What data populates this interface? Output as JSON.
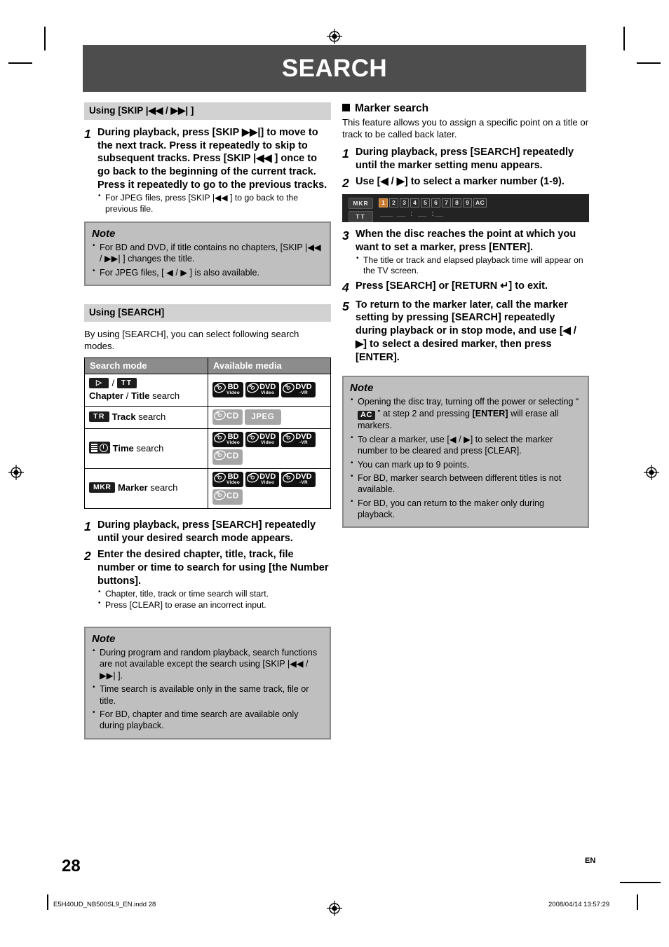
{
  "page": {
    "title": "SEARCH",
    "number": "28",
    "lang": "EN",
    "footer_file": "E5H40UD_NB500SL9_EN.indd   28",
    "footer_date": "2008/04/14   13:57:29"
  },
  "colors": {
    "banner": "#4d4d4d",
    "section_bar": "#d2d2d2",
    "note_bg": "#bfbfbf",
    "note_border": "#8a8a8a",
    "table_header": "#8c8c8c",
    "osd_bg": "#232323",
    "osd_highlight": "#c87a32",
    "media_dark": "#111111",
    "media_gray": "#a6a6a6"
  },
  "left": {
    "skip_section": {
      "bar_label": "Using [SKIP |◀◀ / ▶▶| ]",
      "steps": [
        {
          "num": "1",
          "head_parts": [
            {
              "t": "During playback, press [SKIP ",
              "s": "plain"
            },
            {
              "t": "▶▶|",
              "s": "plain"
            },
            {
              "t": "] to move to the next track. Press it repeatedly to skip to subsequent tracks. Press [SKIP |◀◀ ] once to go back to the beginning of the current track. Press it repeatedly to go to the previous tracks.",
              "s": "plain"
            }
          ],
          "head": "During playback, press [SKIP ▶▶|] to move to the next track. Press it repeatedly to skip to subsequent tracks. Press [SKIP |◀◀ ] once to go back to the beginning of the current track. Press it repeatedly to go to the previous tracks.",
          "bullets": [
            "For JPEG files, press [SKIP |◀◀ ] to go back to the previous file."
          ]
        }
      ],
      "note": {
        "title": "Note",
        "bullets": [
          "For BD and DVD, if title contains no chapters, [SKIP |◀◀ / ▶▶| ] changes the title.",
          "For JPEG files,  [ ◀ / ▶ ] is also available."
        ]
      }
    },
    "search_section": {
      "bar_label": "Using [SEARCH]",
      "intro": "By using [SEARCH], you can select following search modes.",
      "table": {
        "headers": [
          "Search mode",
          "Available media"
        ],
        "rows": [
          {
            "icons": [
              "play-badge",
              "tt-badge"
            ],
            "icon_text": [
              "▶",
              "TT"
            ],
            "label_bold_1": "Chapter",
            "label_sep": " / ",
            "label_bold_2": "Title",
            "label_tail": " search",
            "media": [
              {
                "kind": "disc-dark",
                "l1": "BD",
                "l2": "Video"
              },
              {
                "kind": "disc-dark",
                "l1": "DVD",
                "l2": "Video"
              },
              {
                "kind": "disc-dark",
                "l1": "DVD",
                "l2": "-VR"
              }
            ]
          },
          {
            "icons": [
              "tr-badge"
            ],
            "icon_text": [
              "TR"
            ],
            "label_bold_1": "Track",
            "label_tail": " search",
            "media": [
              {
                "kind": "disc-gray",
                "l1": "CD",
                "l2": ""
              },
              {
                "kind": "plain-gray",
                "l1": "JPEG",
                "l2": ""
              }
            ]
          },
          {
            "icons": [
              "time-icon"
            ],
            "icon_text": [
              ""
            ],
            "label_bold_1": "Time",
            "label_tail": " search",
            "media": [
              {
                "kind": "disc-dark",
                "l1": "BD",
                "l2": "Video"
              },
              {
                "kind": "disc-dark",
                "l1": "DVD",
                "l2": "Video"
              },
              {
                "kind": "disc-dark",
                "l1": "DVD",
                "l2": "-VR"
              },
              {
                "kind": "disc-gray",
                "l1": "CD",
                "l2": ""
              }
            ]
          },
          {
            "icons": [
              "mkr-badge"
            ],
            "icon_text": [
              "MKR"
            ],
            "label_bold_1": "Marker",
            "label_tail": " search",
            "media": [
              {
                "kind": "disc-dark",
                "l1": "BD",
                "l2": "Video"
              },
              {
                "kind": "disc-dark",
                "l1": "DVD",
                "l2": "Video"
              },
              {
                "kind": "disc-dark",
                "l1": "DVD",
                "l2": "-VR"
              },
              {
                "kind": "disc-gray",
                "l1": "CD",
                "l2": ""
              }
            ]
          }
        ]
      },
      "steps": [
        {
          "num": "1",
          "head": "During playback, press [SEARCH] repeatedly until your desired search mode appears.",
          "bullets": []
        },
        {
          "num": "2",
          "head": "Enter the desired chapter, title, track, file number or time to search for using [the Number buttons].",
          "bullets": [
            "Chapter, title, track or time search will start.",
            "Press [CLEAR] to erase an incorrect input."
          ]
        }
      ],
      "note": {
        "title": "Note",
        "bullets": [
          "During program and random playback, search functions are not available except the search using [SKIP |◀◀ / ▶▶| ].",
          "Time search is available only in the same track, file or title.",
          "For BD, chapter and time search are available only during playback."
        ]
      }
    }
  },
  "right": {
    "heading": "Marker search",
    "intro": "This feature allows you to assign a specific point on a title or track to be called back later.",
    "steps": [
      {
        "num": "1",
        "head": "During playback, press [SEARCH] repeatedly until the marker setting menu appears.",
        "bullets": []
      },
      {
        "num": "2",
        "head": "Use [◀ / ▶] to select a marker number (1-9).",
        "bullets": []
      },
      {
        "num": "3",
        "head": "When the disc reaches the point at which you want to set a marker, press [ENTER].",
        "bullets": [
          "The title or track and elapsed playback time will appear on the TV screen."
        ]
      },
      {
        "num": "4",
        "head": "Press [SEARCH] or [RETURN ↵] to exit.",
        "bullets": []
      },
      {
        "num": "5",
        "head": "To return to the marker later, call the marker setting by pressing [SEARCH] repeatedly during playback or in stop mode, and use [◀ / ▶] to select a desired marker, then press [ENTER].",
        "bullets": []
      }
    ],
    "marker_osd": {
      "tab_1": "MKR",
      "tab_2": "TT",
      "numbers": [
        "1",
        "2",
        "3",
        "4",
        "5",
        "6",
        "7",
        "8",
        "9"
      ],
      "all_clear": "AC",
      "selected": "1",
      "time_display": "___  __ : __ :__"
    },
    "note": {
      "title": "Note",
      "bullets": [
        "Opening the disc tray, turning off the power or selecting “ AC ” at step 2 and pressing [ENTER] will erase all markers.",
        "To clear a marker, use [◀ / ▶] to select the marker number to be cleared and press [CLEAR].",
        "You can mark up to 9 points.",
        "For BD, marker search between different titles is not available.",
        "For BD, you can return to the maker only during playback."
      ]
    }
  }
}
